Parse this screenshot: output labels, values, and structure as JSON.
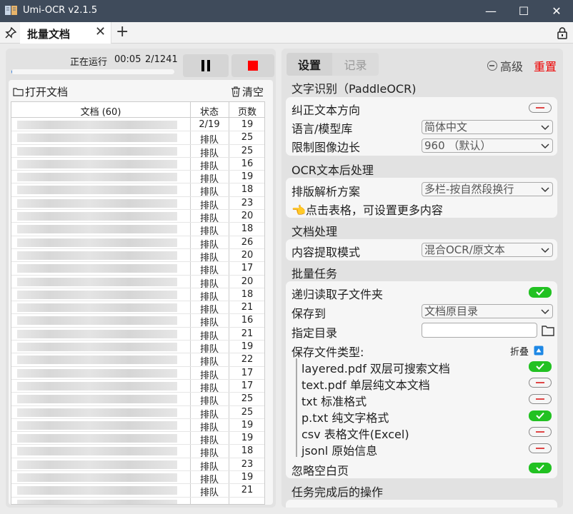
{
  "window": {
    "title": "Umi-OCR v2.1.5",
    "minimize_label": "—",
    "maximize_label": "☐",
    "close_label": "✕"
  },
  "tabs": {
    "active_label": "批量文档",
    "close_label": "✕",
    "add_label": "+"
  },
  "progress": {
    "status": "正在运行",
    "elapsed": "00:05",
    "count": "2/1241",
    "fraction": 0.0016
  },
  "docs": {
    "open_label": "打开文档",
    "clear_label": "清空",
    "col_doc": "文档 (60)",
    "col_status": "状态",
    "col_pages": "页数",
    "rows": [
      {
        "status": "2/19",
        "pages": "19"
      },
      {
        "status": "排队",
        "pages": "25"
      },
      {
        "status": "排队",
        "pages": "25"
      },
      {
        "status": "排队",
        "pages": "16"
      },
      {
        "status": "排队",
        "pages": "19"
      },
      {
        "status": "排队",
        "pages": "18"
      },
      {
        "status": "排队",
        "pages": "23"
      },
      {
        "status": "排队",
        "pages": "20"
      },
      {
        "status": "排队",
        "pages": "18"
      },
      {
        "status": "排队",
        "pages": "26"
      },
      {
        "status": "排队",
        "pages": "20"
      },
      {
        "status": "排队",
        "pages": "17"
      },
      {
        "status": "排队",
        "pages": "20"
      },
      {
        "status": "排队",
        "pages": "18"
      },
      {
        "status": "排队",
        "pages": "21"
      },
      {
        "status": "排队",
        "pages": "16"
      },
      {
        "status": "排队",
        "pages": "21"
      },
      {
        "status": "排队",
        "pages": "19"
      },
      {
        "status": "排队",
        "pages": "22"
      },
      {
        "status": "排队",
        "pages": "17"
      },
      {
        "status": "排队",
        "pages": "17"
      },
      {
        "status": "排队",
        "pages": "25"
      },
      {
        "status": "排队",
        "pages": "25"
      },
      {
        "status": "排队",
        "pages": "19"
      },
      {
        "status": "排队",
        "pages": "19"
      },
      {
        "status": "排队",
        "pages": "18"
      },
      {
        "status": "排队",
        "pages": "23"
      },
      {
        "status": "排队",
        "pages": "19"
      },
      {
        "status": "排队",
        "pages": "21"
      },
      {
        "status": "",
        "pages": ""
      }
    ]
  },
  "settings": {
    "tab_settings": "设置",
    "tab_records": "记录",
    "advanced_label": "高级",
    "reset_label": "重置",
    "ocr": {
      "title": "文字识别（PaddleOCR)",
      "correct_direction": "纠正文本方向",
      "correct_direction_on": false,
      "language_label": "语言/模型库",
      "language_value": "简体中文",
      "limit_label": "限制图像边长",
      "limit_value": "960 （默认）"
    },
    "post": {
      "title": "OCR文本后处理",
      "layout_label": "排版解析方案",
      "layout_value": "多栏-按自然段换行",
      "hint": "👈点击表格，可设置更多内容"
    },
    "docproc": {
      "title": "文档处理",
      "mode_label": "内容提取模式",
      "mode_value": "混合OCR/原文本"
    },
    "batch": {
      "title": "批量任务",
      "recursive_label": "递归读取子文件夹",
      "recursive_on": true,
      "save_to_label": "保存到",
      "save_to_value": "文档原目录",
      "dir_label": "指定目录",
      "dir_value": "",
      "types_label": "保存文件类型:",
      "collapse_label": "折叠",
      "types": [
        {
          "label": "layered.pdf 双层可搜索文档",
          "on": true
        },
        {
          "label": "text.pdf 单层纯文本文档",
          "on": false
        },
        {
          "label": "txt 标准格式",
          "on": false
        },
        {
          "label": "p.txt 纯文字格式",
          "on": true
        },
        {
          "label": "csv 表格文件(Excel)",
          "on": false
        },
        {
          "label": "jsonl 原始信息",
          "on": false
        }
      ],
      "ignore_blank_label": "忽略空白页",
      "ignore_blank_on": true
    },
    "after": {
      "title": "任务完成后的操作"
    }
  },
  "colors": {
    "titlebar": "#3f4b5b",
    "accent": "#2f7ad8",
    "toggle_on": "#22c122",
    "stop": "#ff0000",
    "reset": "#e00000"
  }
}
